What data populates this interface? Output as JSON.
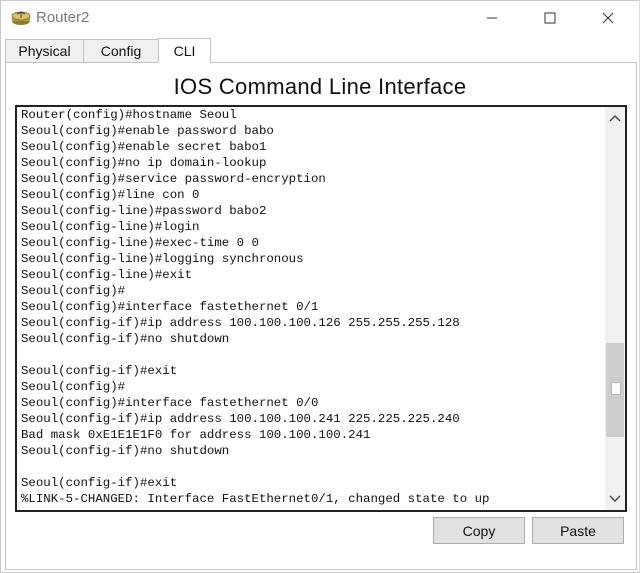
{
  "window": {
    "title": "Router2",
    "icons": {
      "app": "router-icon",
      "minimize": "minimize-icon",
      "maximize": "maximize-icon",
      "close": "close-icon"
    }
  },
  "tabs": [
    {
      "label": "Physical",
      "active": false
    },
    {
      "label": "Config",
      "active": false
    },
    {
      "label": "CLI",
      "active": true
    }
  ],
  "cli": {
    "heading": "IOS Command Line Interface",
    "lines": [
      "Router(config)#hostname Seoul",
      "Seoul(config)#enable password babo",
      "Seoul(config)#enable secret babo1",
      "Seoul(config)#no ip domain-lookup",
      "Seoul(config)#service password-encryption",
      "Seoul(config)#line con 0",
      "Seoul(config-line)#password babo2",
      "Seoul(config-line)#login",
      "Seoul(config-line)#exec-time 0 0",
      "Seoul(config-line)#logging synchronous",
      "Seoul(config-line)#exit",
      "Seoul(config)#",
      "Seoul(config)#interface fastethernet 0/1",
      "Seoul(config-if)#ip address 100.100.100.126 255.255.255.128",
      "Seoul(config-if)#no shutdown",
      "",
      "Seoul(config-if)#exit",
      "Seoul(config)#",
      "Seoul(config)#interface fastethernet 0/0",
      "Seoul(config-if)#ip address 100.100.100.241 225.225.225.240",
      "Bad mask 0xE1E1E1F0 for address 100.100.100.241",
      "Seoul(config-if)#no shutdown",
      "",
      "Seoul(config-if)#exit",
      "%LINK-5-CHANGED: Interface FastEthernet0/1, changed state to up"
    ]
  },
  "buttons": {
    "copy": "Copy",
    "paste": "Paste"
  }
}
